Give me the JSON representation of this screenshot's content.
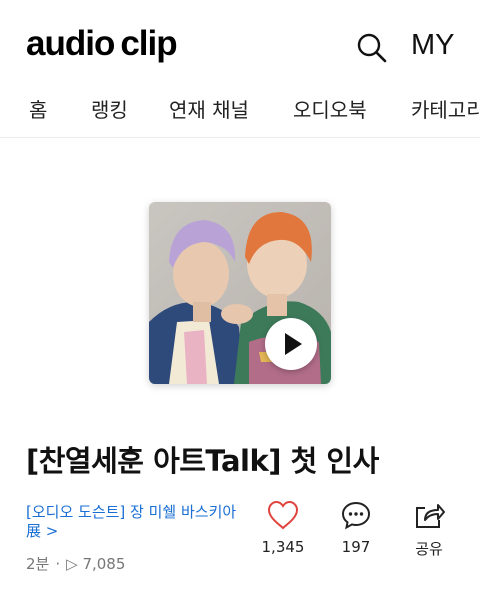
{
  "app": {
    "logo_word1": "audio",
    "logo_word2": "clip",
    "my_label": "MY",
    "search_icon": "search-icon"
  },
  "nav": {
    "items": [
      "홈",
      "랭킹",
      "연재 채널",
      "오디오북",
      "카테고리"
    ]
  },
  "episode": {
    "title": "[찬열세훈 아트Talk] 첫 인사",
    "series_line1": "[오디오 도슨트] 장 미쉘 바스키아",
    "series_line2": "展 >",
    "duration": "2분",
    "play_count": "7,085"
  },
  "actions": {
    "like_count": "1,345",
    "comment_count": "197",
    "share_label": "공유"
  },
  "colors": {
    "link": "#1a6fd4",
    "like_icon": "#e0443f",
    "text": "#111111",
    "muted": "#777777"
  }
}
